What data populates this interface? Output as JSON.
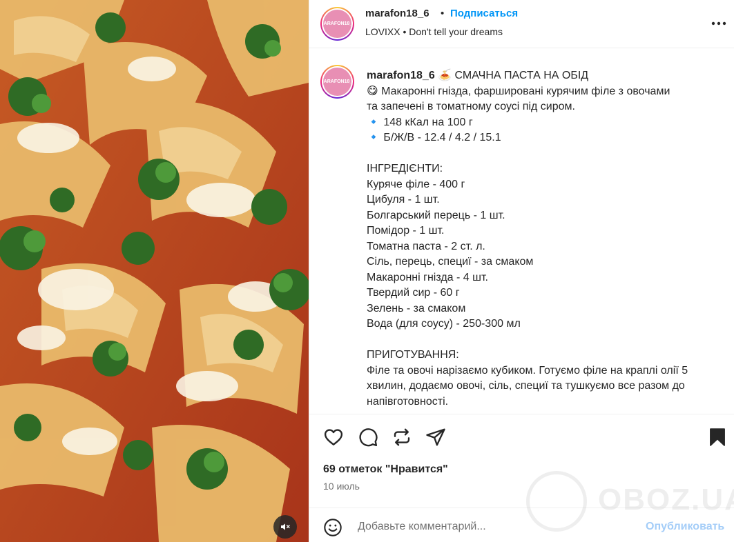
{
  "header": {
    "avatar_text": "MARAFON18_6",
    "username": "marafon18_6",
    "dot": "•",
    "follow_label": "Подписаться",
    "subtitle": "LOVIXX • Don't tell your dreams"
  },
  "caption": {
    "username": "marafon18_6",
    "title": "🍝 СМАЧНА ПАСТА НА ОБІД",
    "lines": [
      "😋 Макаронні гнізда, фаршировані курячим філе з овочами",
      "та запечені в томатному соусі під сиром.",
      "🔹 148 кКал на 100 г",
      "🔹 Б/Ж/В - 12.4 / 4.2 / 15.1",
      "",
      "ІНГРЕДІЄНТИ:",
      "Куряче філе - 400 г",
      "Цибуля - 1 шт.",
      "Болгарський перець - 1 шт.",
      "Помідор - 1 шт.",
      "Томатна паста - 2 ст. л.",
      "Сіль, перець, специї - за смаком",
      "Макаронні гнізда - 4 шт.",
      "Твердий сир - 60 г",
      "Зелень - за смаком",
      "Вода (для соусу) - 250-300 мл",
      "",
      "ПРИГОТУВАННЯ:",
      "Філе та овочі нарізаємо кубиком. Готуємо філе на краплі олії 5",
      "хвилин, додаємо овочі, сіль, специї та тушкуємо все разом до",
      "напівготовності."
    ]
  },
  "actions": {
    "like_icon": "heart-icon",
    "comment_icon": "comment-icon",
    "share_icon": "repost-icon",
    "send_icon": "send-icon",
    "save_icon": "bookmark-icon"
  },
  "likes_text": "69 отметок \"Нравится\"",
  "date_text": "10 июль",
  "comment": {
    "placeholder": "Добавьте комментарий...",
    "publish_label": "Опубликовать"
  },
  "watermark": "OBOZ.UA",
  "colors": {
    "link_blue": "#0095f6",
    "publish_disabled": "#a4cdf8",
    "text": "#262626",
    "muted": "#737373"
  }
}
